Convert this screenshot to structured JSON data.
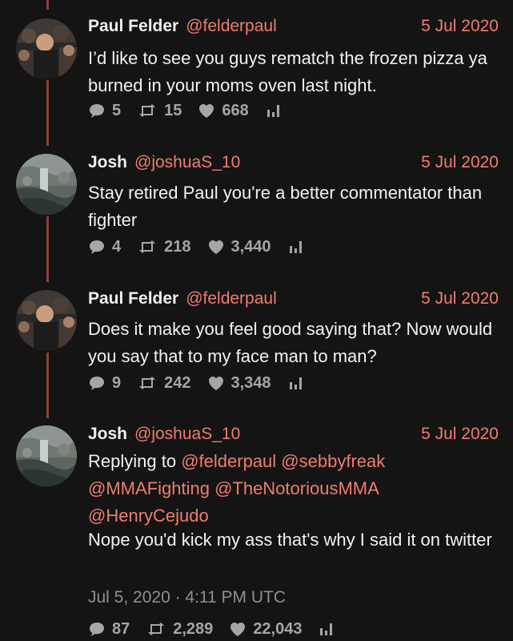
{
  "tweets": [
    {
      "avatar": "avatar-crowd",
      "name": "Paul Felder",
      "handle": "@felderpaul",
      "date": "5 Jul 2020",
      "text": "I’d like to see you guys rematch the frozen pizza ya burned in your moms oven last night.",
      "replies": "5",
      "retweets": "15",
      "likes": "668"
    },
    {
      "avatar": "avatar-waterfall",
      "name": "Josh",
      "handle": "@joshuaS_10",
      "date": "5 Jul 2020",
      "text": "Stay retired Paul you're a better commentator than fighter",
      "replies": "4",
      "retweets": "218",
      "likes": "3,440"
    },
    {
      "avatar": "avatar-crowd",
      "name": "Paul Felder",
      "handle": "@felderpaul",
      "date": "5 Jul 2020",
      "text": "Does it make you feel good saying that? Now would you say that to my face man to man?",
      "replies": "9",
      "retweets": "242",
      "likes": "3,348"
    },
    {
      "avatar": "avatar-waterfall",
      "name": "Josh",
      "handle": "@joshuaS_10",
      "date": "5 Jul 2020",
      "replying_label": "Replying to",
      "mentions": [
        "@felderpaul",
        "@sebbyfreak",
        "@MMAFighting",
        "@TheNotoriousMMA",
        "@HenryCejudo"
      ],
      "text": "Nope you'd kick my ass that's why I said it on twitter",
      "timestamp": "Jul 5, 2020 · 4:11 PM UTC",
      "replies": "87",
      "retweets": "2,289",
      "likes": "22,043"
    }
  ],
  "colors": {
    "background": "#141414",
    "accent": "#f07d6b",
    "thread_line": "#8a4238",
    "muted": "#8e8e8e"
  },
  "icons": [
    "reply-icon",
    "retweet-icon",
    "like-icon",
    "analytics-icon"
  ]
}
